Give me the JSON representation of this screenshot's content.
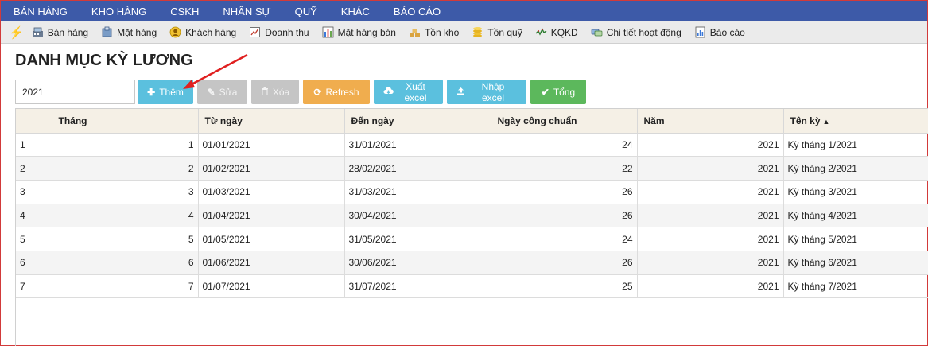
{
  "topmenu": [
    "BÁN HÀNG",
    "KHO HÀNG",
    "CSKH",
    "NHÂN SỰ",
    "QUỸ",
    "KHÁC",
    "BÁO CÁO"
  ],
  "quickbar": [
    {
      "label": "Bán hàng",
      "icon": "cash-register-icon"
    },
    {
      "label": "Mặt hàng",
      "icon": "box-icon"
    },
    {
      "label": "Khách hàng",
      "icon": "customer-icon"
    },
    {
      "label": "Doanh thu",
      "icon": "revenue-icon"
    },
    {
      "label": "Mặt hàng bán",
      "icon": "bar-chart-icon"
    },
    {
      "label": "Tồn kho",
      "icon": "stock-icon"
    },
    {
      "label": "Tồn quỹ",
      "icon": "coins-icon"
    },
    {
      "label": "KQKD",
      "icon": "trend-icon"
    },
    {
      "label": "Chi tiết hoạt động",
      "icon": "activity-icon"
    },
    {
      "label": "Báo cáo",
      "icon": "report-icon"
    }
  ],
  "page": {
    "title": "DANH MỤC KỲ LƯƠNG"
  },
  "toolbar": {
    "year_value": "2021",
    "add": "Thêm",
    "edit": "Sửa",
    "delete": "Xóa",
    "refresh": "Refresh",
    "export": "Xuất excel",
    "import": "Nhập excel",
    "total": "Tổng"
  },
  "table": {
    "headers": [
      "",
      "Tháng",
      "Từ ngày",
      "Đến ngày",
      "Ngày công chuẩn",
      "Năm",
      "Tên kỳ"
    ],
    "sort_indicator": "▲",
    "rows": [
      [
        "1",
        "1",
        "01/01/2021",
        "31/01/2021",
        "24",
        "2021",
        "Kỳ tháng 1/2021"
      ],
      [
        "2",
        "2",
        "01/02/2021",
        "28/02/2021",
        "22",
        "2021",
        "Kỳ tháng 2/2021"
      ],
      [
        "3",
        "3",
        "01/03/2021",
        "31/03/2021",
        "26",
        "2021",
        "Kỳ tháng 3/2021"
      ],
      [
        "4",
        "4",
        "01/04/2021",
        "30/04/2021",
        "26",
        "2021",
        "Kỳ tháng 4/2021"
      ],
      [
        "5",
        "5",
        "01/05/2021",
        "31/05/2021",
        "24",
        "2021",
        "Kỳ tháng 5/2021"
      ],
      [
        "6",
        "6",
        "01/06/2021",
        "30/06/2021",
        "26",
        "2021",
        "Kỳ tháng 6/2021"
      ],
      [
        "7",
        "7",
        "01/07/2021",
        "31/07/2021",
        "25",
        "2021",
        "Kỳ tháng 7/2021"
      ]
    ]
  },
  "colors": {
    "menu_bg": "#3d5aa8",
    "annotation_arrow": "#e02020"
  }
}
